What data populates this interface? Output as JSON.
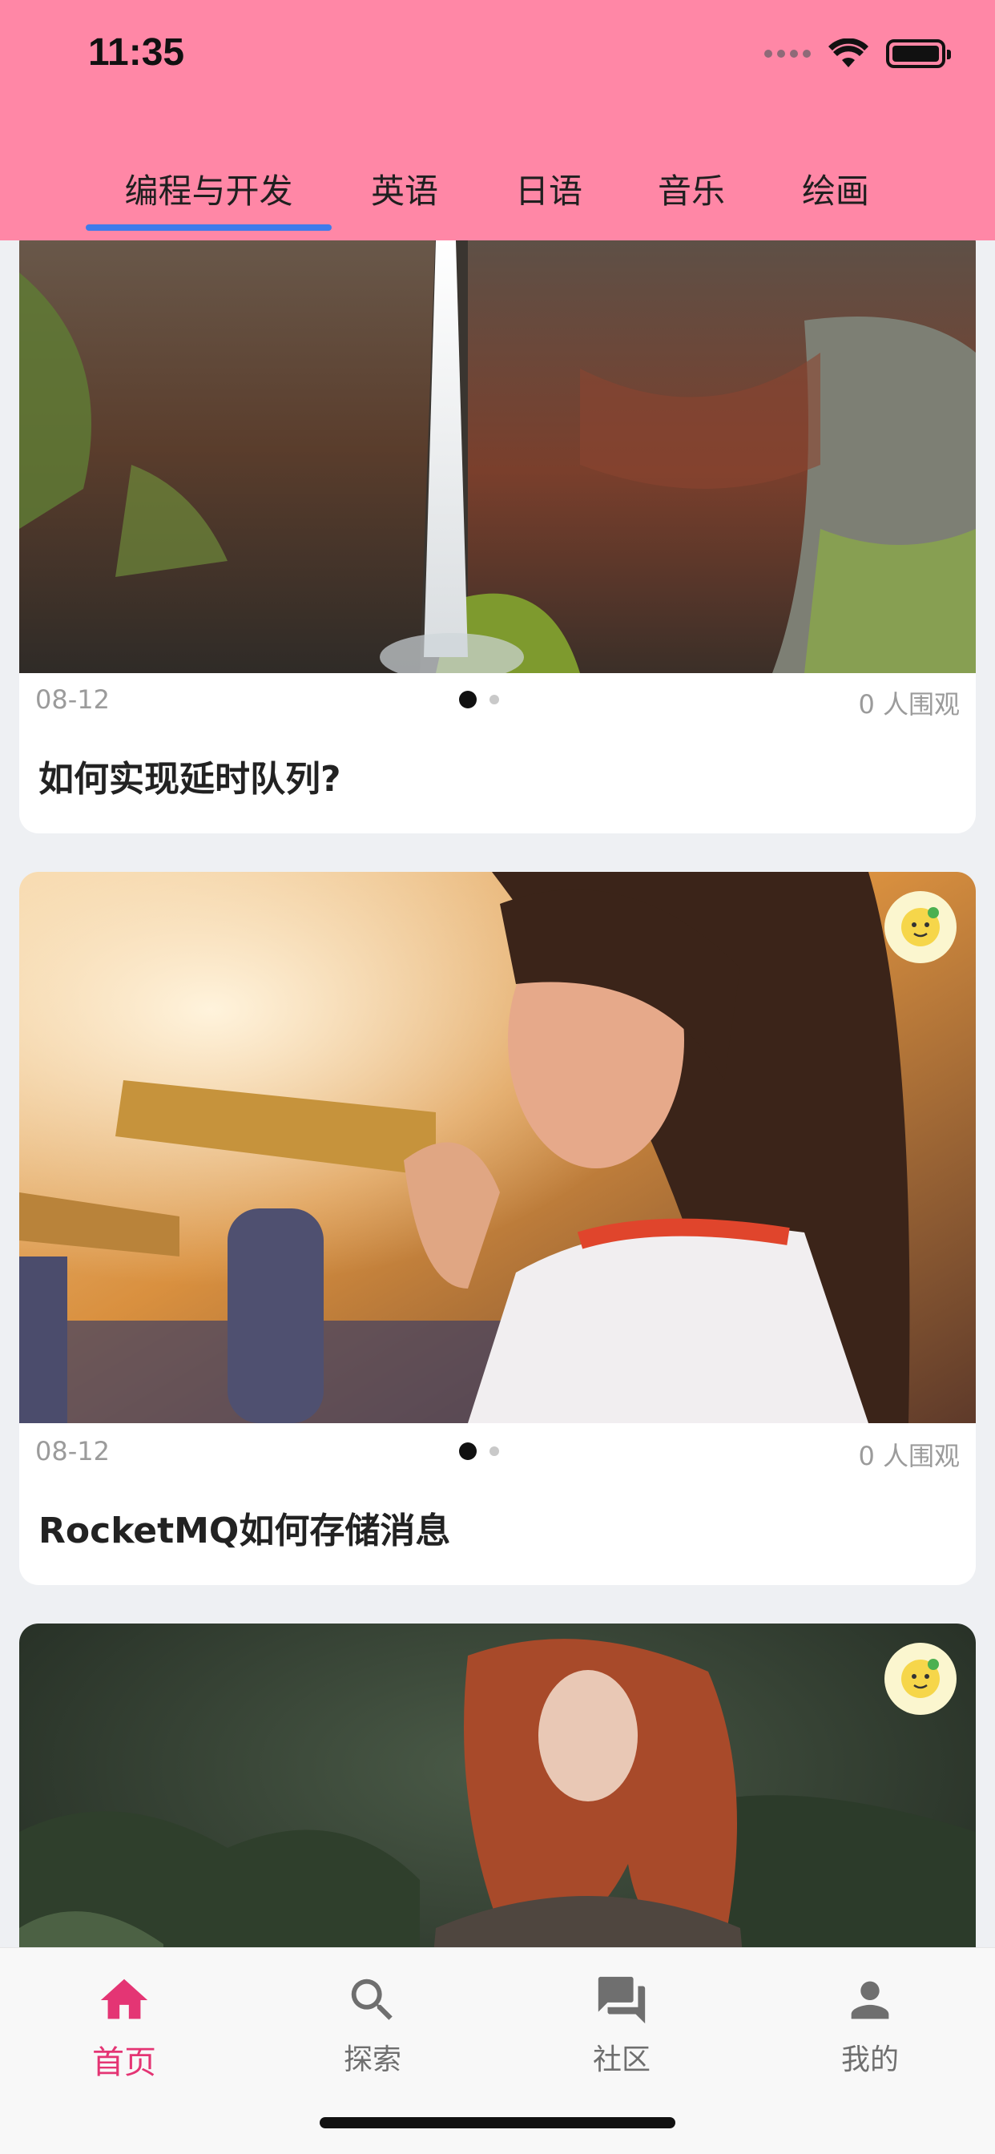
{
  "status_bar": {
    "time": "11:35"
  },
  "tabs": [
    {
      "label": "编程与开发",
      "active": true
    },
    {
      "label": "英语",
      "active": false
    },
    {
      "label": "日语",
      "active": false
    },
    {
      "label": "音乐",
      "active": false
    },
    {
      "label": "绘画",
      "active": false
    }
  ],
  "cards": [
    {
      "date": "08-12",
      "views": "0 人围观",
      "title": "如何实现延时队列?",
      "image": "waterfall-canyon-photo"
    },
    {
      "date": "08-12",
      "views": "0 人围观",
      "title": "RocketMQ如何存储消息",
      "image": "woman-at-binocular-photo",
      "badge": "lemon-sticker-icon"
    },
    {
      "image": "red-haired-woman-forest-photo",
      "badge": "lemon-sticker-icon"
    }
  ],
  "bottom_nav": [
    {
      "label": "首页",
      "icon": "home-icon",
      "active": true
    },
    {
      "label": "探索",
      "icon": "search-icon",
      "active": false
    },
    {
      "label": "社区",
      "icon": "chat-icon",
      "active": false
    },
    {
      "label": "我的",
      "icon": "person-icon",
      "active": false
    }
  ],
  "colors": {
    "header_bg": "#ff87a6",
    "tab_indicator": "#3f7bea",
    "nav_active": "#e43574",
    "page_bg": "#eef0f3"
  }
}
